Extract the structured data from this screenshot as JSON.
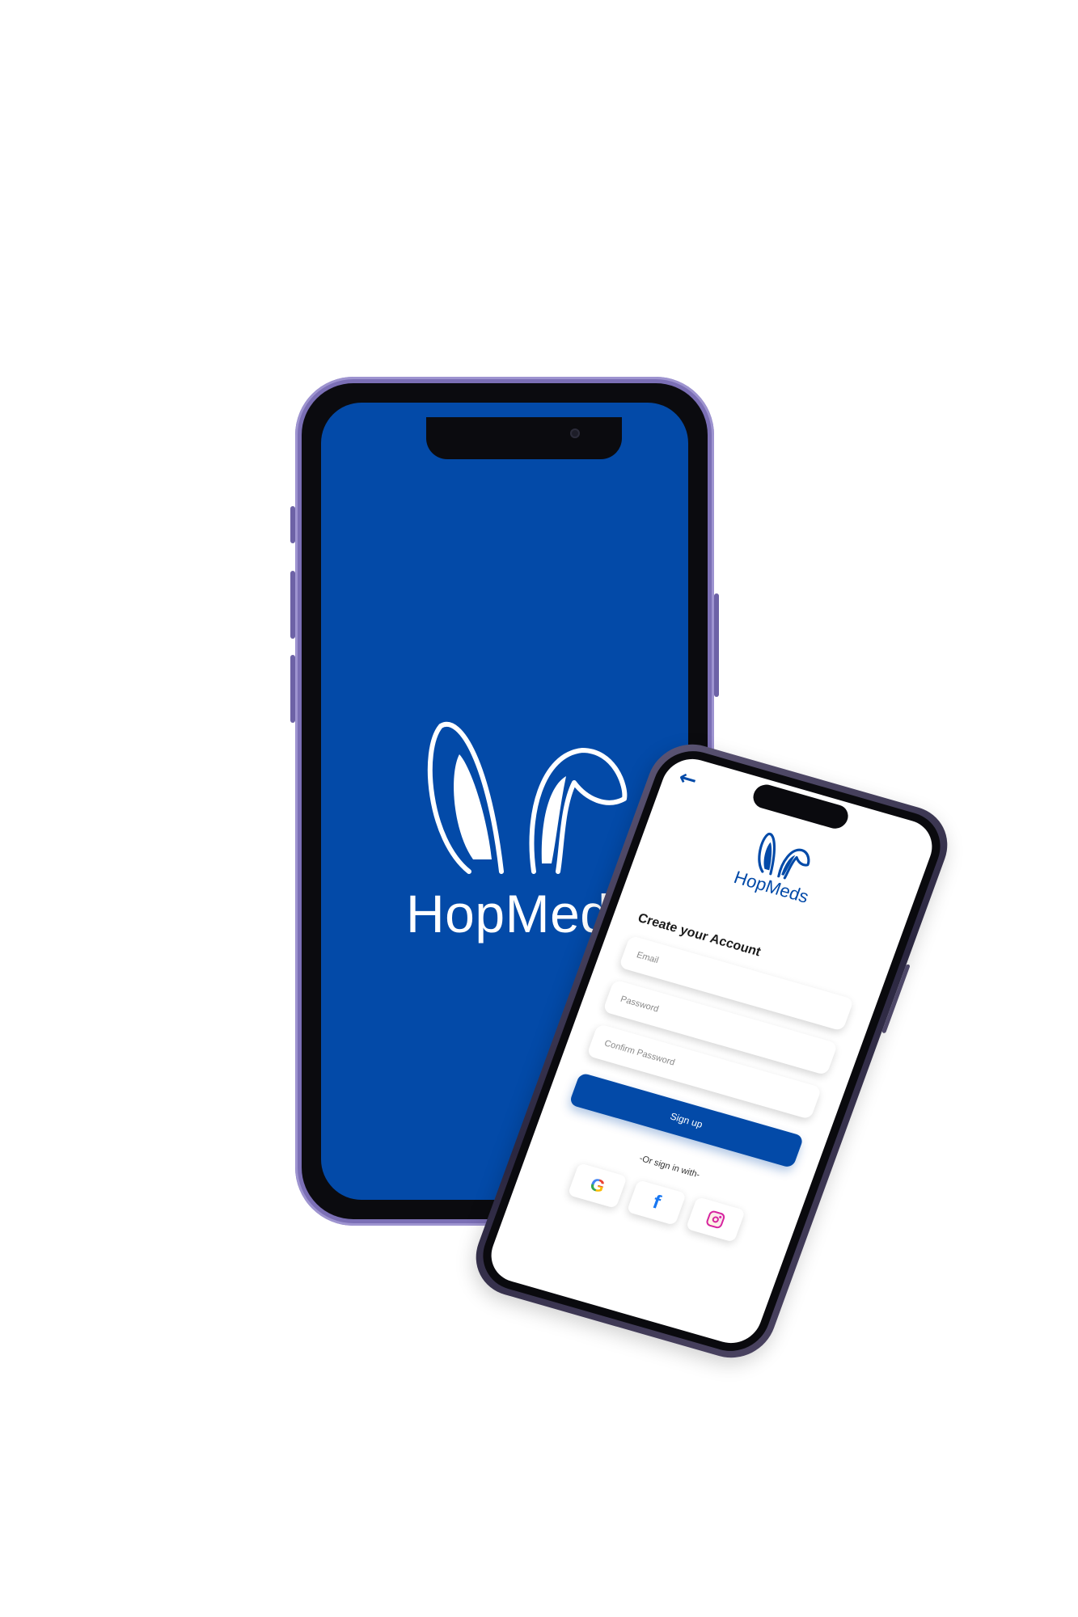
{
  "colors": {
    "brand": "#034aa8",
    "frame_front": "#7b6fb5",
    "frame_back": "#2b2740"
  },
  "splash": {
    "brand_name": "HopMeds",
    "logo_icon": "bunny-ears-icon"
  },
  "signup": {
    "back_icon": "arrow-left-icon",
    "back_glyph": "←",
    "brand_name": "HopMeds",
    "title": "Create your Account",
    "fields": {
      "email_placeholder": "Email",
      "password_placeholder": "Password",
      "confirm_placeholder": "Confirm Password"
    },
    "signup_label": "Sign up",
    "or_text": "-Or sign in with-",
    "social": [
      {
        "icon": "google-icon",
        "glyph": "G"
      },
      {
        "icon": "facebook-icon",
        "glyph": "f"
      },
      {
        "icon": "instagram-icon",
        "glyph": ""
      }
    ]
  }
}
